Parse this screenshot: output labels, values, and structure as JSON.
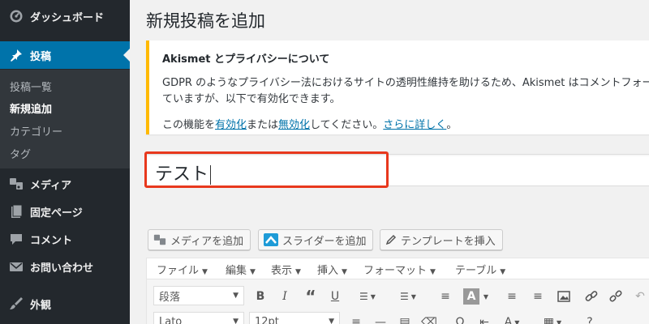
{
  "sidebar": {
    "items": [
      {
        "label": "ダッシュボード",
        "icon": "dashboard-icon"
      },
      {
        "label": "投稿",
        "icon": "pin-icon"
      },
      {
        "label": "メディア",
        "icon": "media-icon"
      },
      {
        "label": "固定ページ",
        "icon": "page-icon"
      },
      {
        "label": "コメント",
        "icon": "comment-icon"
      },
      {
        "label": "お問い合わせ",
        "icon": "mail-icon"
      },
      {
        "label": "外観",
        "icon": "brush-icon"
      }
    ],
    "submenu": [
      "投稿一覧",
      "新規追加",
      "カテゴリー",
      "タグ"
    ],
    "active_color": "#0073aa"
  },
  "page": {
    "title": "新規投稿を追加"
  },
  "notice": {
    "heading": "Akismet とプライバシーについて",
    "line1": "GDPR のようなプライバシー法におけるサイトの透明性維持を助けるため、Akismet はコメントフォー",
    "line2": "ていますが、以下で有効化できます。",
    "p2_before": "この機能を",
    "link_enable": "有効化",
    "p2_mid": "または",
    "link_disable": "無効化",
    "p2_after": "してください。",
    "link_more": "さらに詳しく",
    "p2_end": "。",
    "accent_color": "#ffb900"
  },
  "title_input": {
    "value": "テスト",
    "highlight_color": "#e8381d"
  },
  "media_buttons": [
    "メディアを追加",
    "スライダーを追加",
    "テンプレートを挿入"
  ],
  "editor": {
    "menus": [
      "ファイル",
      "編集",
      "表示",
      "挿入",
      "フォーマット",
      "テーブル"
    ],
    "format_select": "段落",
    "font_select": "Lato",
    "size_select": "12pt"
  }
}
